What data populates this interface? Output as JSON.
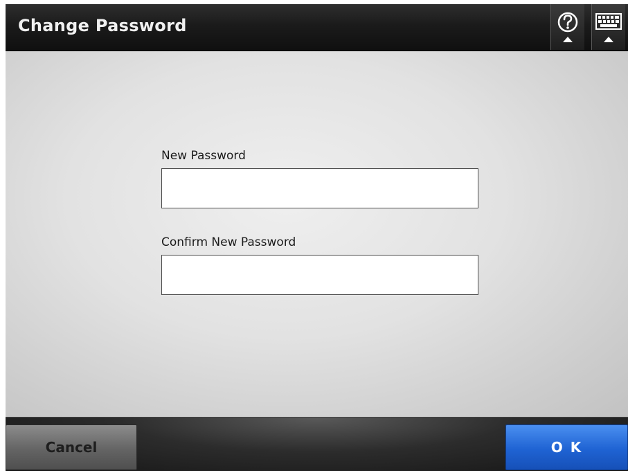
{
  "header": {
    "title": "Change Password",
    "help_icon": "help-icon",
    "keyboard_icon": "keyboard-icon"
  },
  "form": {
    "new_password_label": "New Password",
    "new_password_value": "",
    "confirm_password_label": "Confirm New Password",
    "confirm_password_value": ""
  },
  "footer": {
    "cancel_label": "Cancel",
    "ok_label": "O K"
  },
  "colors": {
    "header_bg": "#1b1b1b",
    "ok_accent": "#1f63d3",
    "cancel_bg": "#646464"
  }
}
